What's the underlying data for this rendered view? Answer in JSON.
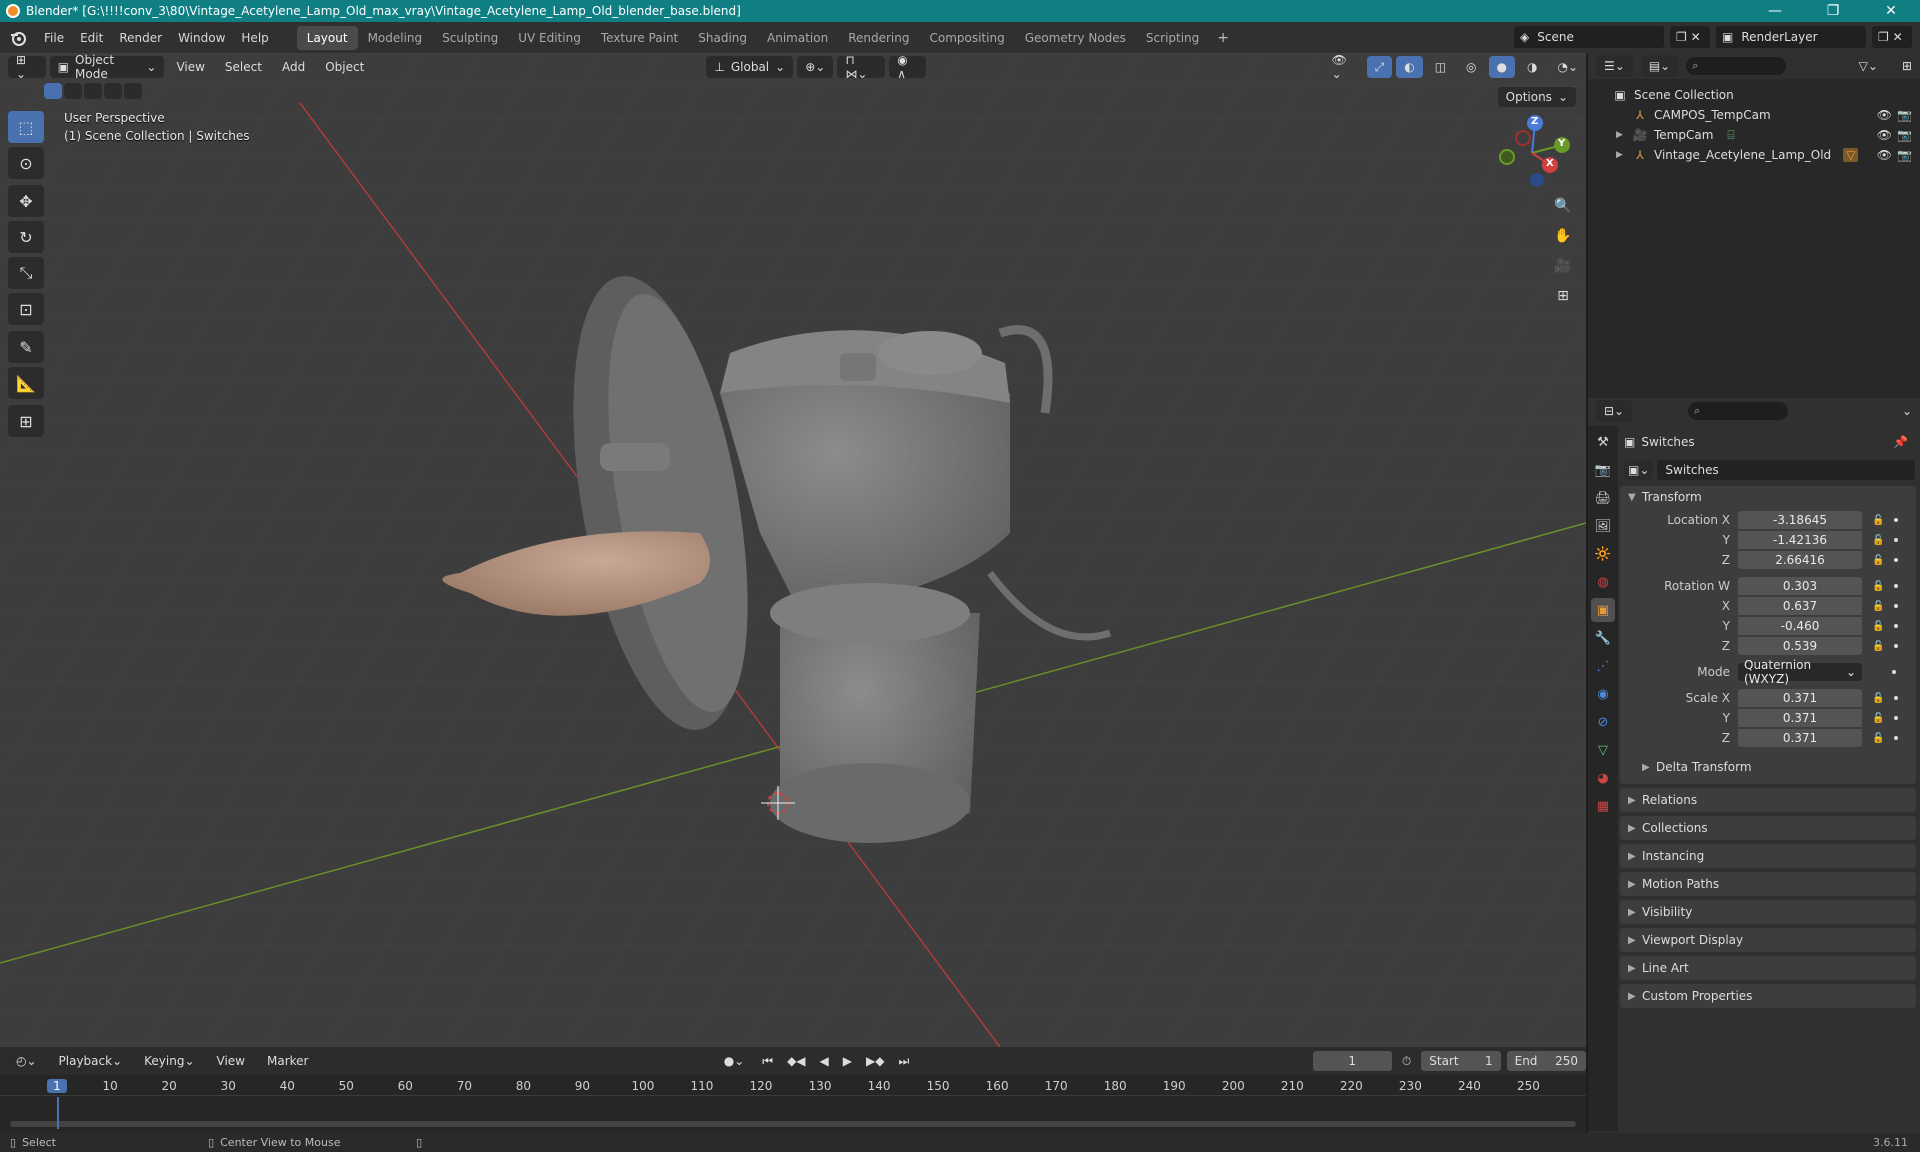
{
  "window": {
    "title": "Blender* [G:\\!!!!conv_3\\80\\Vintage_Acetylene_Lamp_Old_max_vray\\Vintage_Acetylene_Lamp_Old_blender_base.blend]",
    "minimize": "—",
    "maximize": "❐",
    "close": "✕"
  },
  "menu": {
    "items": [
      "File",
      "Edit",
      "Render",
      "Window",
      "Help"
    ],
    "workspaces": [
      "Layout",
      "Modeling",
      "Sculpting",
      "UV Editing",
      "Texture Paint",
      "Shading",
      "Animation",
      "Rendering",
      "Compositing",
      "Geometry Nodes",
      "Scripting"
    ],
    "active_workspace": "Layout",
    "add_workspace": "+",
    "scene": "Scene",
    "render_layer": "RenderLayer"
  },
  "viewport": {
    "mode": "Object Mode",
    "menus": [
      "View",
      "Select",
      "Add",
      "Object"
    ],
    "orientation": "Global",
    "options": "Options",
    "overlay_line1": "User Perspective",
    "overlay_line2": "(1) Scene Collection | Switches",
    "gizmo": {
      "x": "X",
      "y": "Y",
      "z": "Z"
    }
  },
  "outliner": {
    "search_placeholder": "",
    "root": "Scene Collection",
    "items": [
      {
        "name": "CAMPOS_TempCam"
      },
      {
        "name": "TempCam"
      },
      {
        "name": "Vintage_Acetylene_Lamp_Old"
      }
    ]
  },
  "properties": {
    "object_name": "Switches",
    "object_field": "Switches",
    "transform_title": "Transform",
    "location": {
      "label": "Location X",
      "x": "-3.18645",
      "y_label": "Y",
      "y": "-1.42136",
      "z_label": "Z",
      "z": "2.66416"
    },
    "rotation": {
      "label": "Rotation W",
      "w": "0.303",
      "x_label": "X",
      "x": "0.637",
      "y_label": "Y",
      "y": "-0.460",
      "z_label": "Z",
      "z": "0.539"
    },
    "mode": {
      "label": "Mode",
      "value": "Quaternion (WXYZ)"
    },
    "scale": {
      "label": "Scale X",
      "x": "0.371",
      "y_label": "Y",
      "y": "0.371",
      "z_label": "Z",
      "z": "0.371"
    },
    "delta_transform": "Delta Transform",
    "panels": [
      "Relations",
      "Collections",
      "Instancing",
      "Motion Paths",
      "Visibility",
      "Viewport Display",
      "Line Art",
      "Custom Properties"
    ]
  },
  "timeline": {
    "menus": [
      "Playback",
      "Keying",
      "View",
      "Marker"
    ],
    "current_frame": "1",
    "start_label": "Start",
    "start": "1",
    "end_label": "End",
    "end": "250",
    "ticks": [
      "1",
      "10",
      "20",
      "30",
      "40",
      "50",
      "60",
      "70",
      "80",
      "90",
      "100",
      "110",
      "120",
      "130",
      "140",
      "150",
      "160",
      "170",
      "180",
      "190",
      "200",
      "210",
      "220",
      "230",
      "240",
      "250"
    ]
  },
  "status": {
    "select": "Select",
    "center_view": "Center View to Mouse",
    "version": "3.6.11"
  },
  "colors": {
    "title_bar": "#0f7f84",
    "viewport_bg": "#3d3d3d",
    "accent_blue": "#4a72b0",
    "axis_x": "#c23a3a",
    "axis_y": "#6d9a2a",
    "lamp_body": "#7a7a7a",
    "flame": "#b89482"
  }
}
